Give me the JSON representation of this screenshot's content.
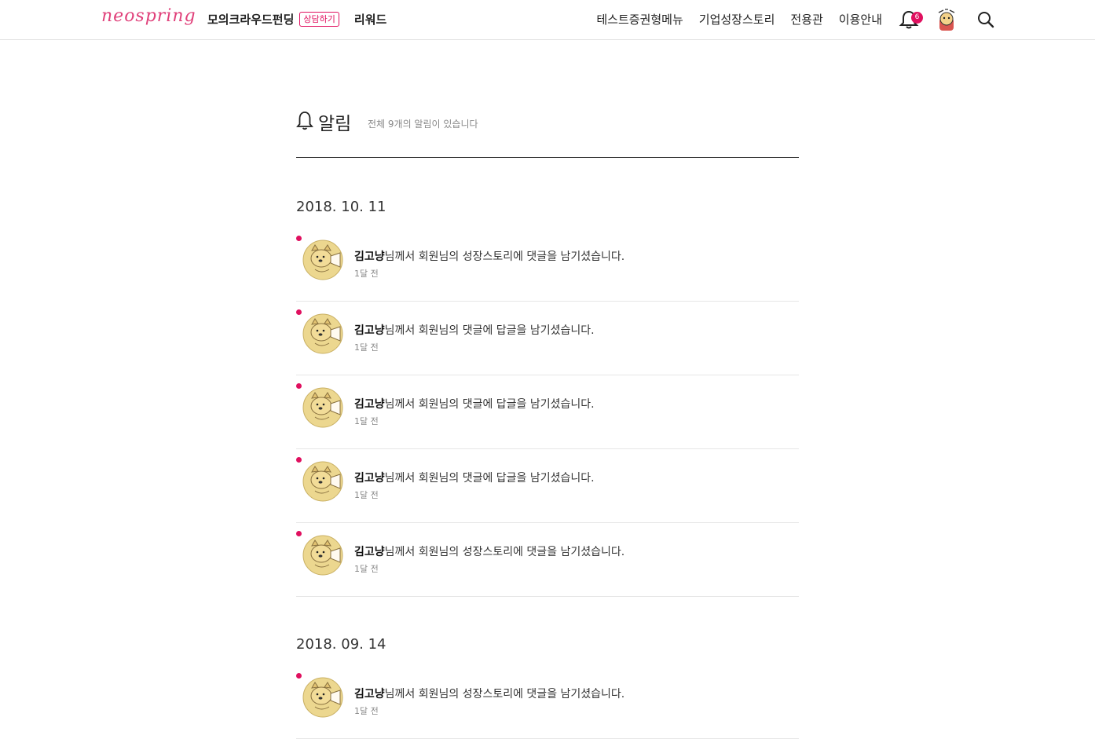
{
  "header": {
    "logo": "neospring",
    "nav_left": [
      "모의크라우드펀딩",
      "리워드"
    ],
    "consult_badge": "상담하기",
    "nav_right": [
      "테스트증권형메뉴",
      "기업성장스토리",
      "전용관",
      "이용안내"
    ],
    "notification_count": "6",
    "icons": [
      "bell-icon",
      "user-avatar-icon",
      "search-icon"
    ],
    "accent_color": "#e0105f"
  },
  "page": {
    "title": "알림",
    "subtitle": "전체 9개의 알림이 있습니다"
  },
  "groups": [
    {
      "date": "2018. 10. 11",
      "items": [
        {
          "name": "김고냥",
          "text": "님께서 회원님의 성장스토리에 댓글을 남기셨습니다.",
          "time": "1달 전"
        },
        {
          "name": "김고냥",
          "text": "님께서 회원님의 댓글에 답글을 남기셨습니다.",
          "time": "1달 전"
        },
        {
          "name": "김고냥",
          "text": "님께서 회원님의 댓글에 답글을 남기셨습니다.",
          "time": "1달 전"
        },
        {
          "name": "김고냥",
          "text": "님께서 회원님의 댓글에 답글을 남기셨습니다.",
          "time": "1달 전"
        },
        {
          "name": "김고냥",
          "text": "님께서 회원님의 성장스토리에 댓글을 남기셨습니다.",
          "time": "1달 전"
        }
      ]
    },
    {
      "date": "2018. 09. 14",
      "items": [
        {
          "name": "김고냥",
          "text": "님께서 회원님의 성장스토리에 댓글을 남기셨습니다.",
          "time": "1달 전"
        }
      ]
    }
  ]
}
